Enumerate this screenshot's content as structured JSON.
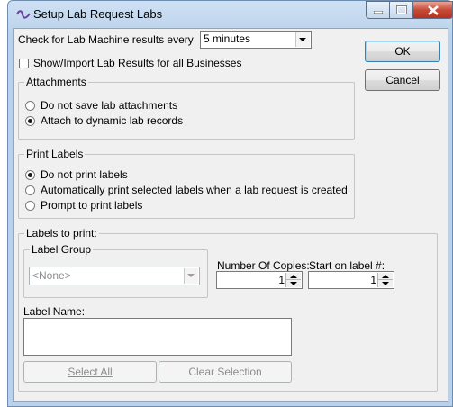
{
  "window": {
    "title": "Setup Lab Request Labs",
    "icon": "lab-icon",
    "accent": "#b9d1ea",
    "close_color": "#c74a38"
  },
  "check_results": {
    "label": "Check for Lab Machine results every",
    "value": "5 minutes"
  },
  "show_import": {
    "label": "Show/Import Lab Results for all Businesses",
    "checked": false
  },
  "buttons": {
    "ok": "OK",
    "cancel": "Cancel",
    "select_all": "Select All",
    "clear_selection": "Clear Selection"
  },
  "attachments": {
    "title": "Attachments",
    "options": [
      {
        "label": "Do not save lab attachments",
        "selected": false
      },
      {
        "label": "Attach to dynamic lab records",
        "selected": true
      }
    ]
  },
  "print_labels": {
    "title": "Print Labels",
    "options": [
      {
        "label": "Do not print labels",
        "selected": true
      },
      {
        "label": "Automatically print selected labels when a lab request is created",
        "selected": false
      },
      {
        "label": "Prompt to print labels",
        "selected": false
      }
    ]
  },
  "labels_to_print": {
    "title": "Labels to print:",
    "label_group": {
      "title": "Label Group",
      "value": "<None>"
    },
    "number_of_copies": {
      "label": "Number Of Copies:",
      "value": "1"
    },
    "start_on_label": {
      "label": "Start on label #:",
      "value": "1"
    },
    "label_name": {
      "label": "Label Name:"
    }
  }
}
